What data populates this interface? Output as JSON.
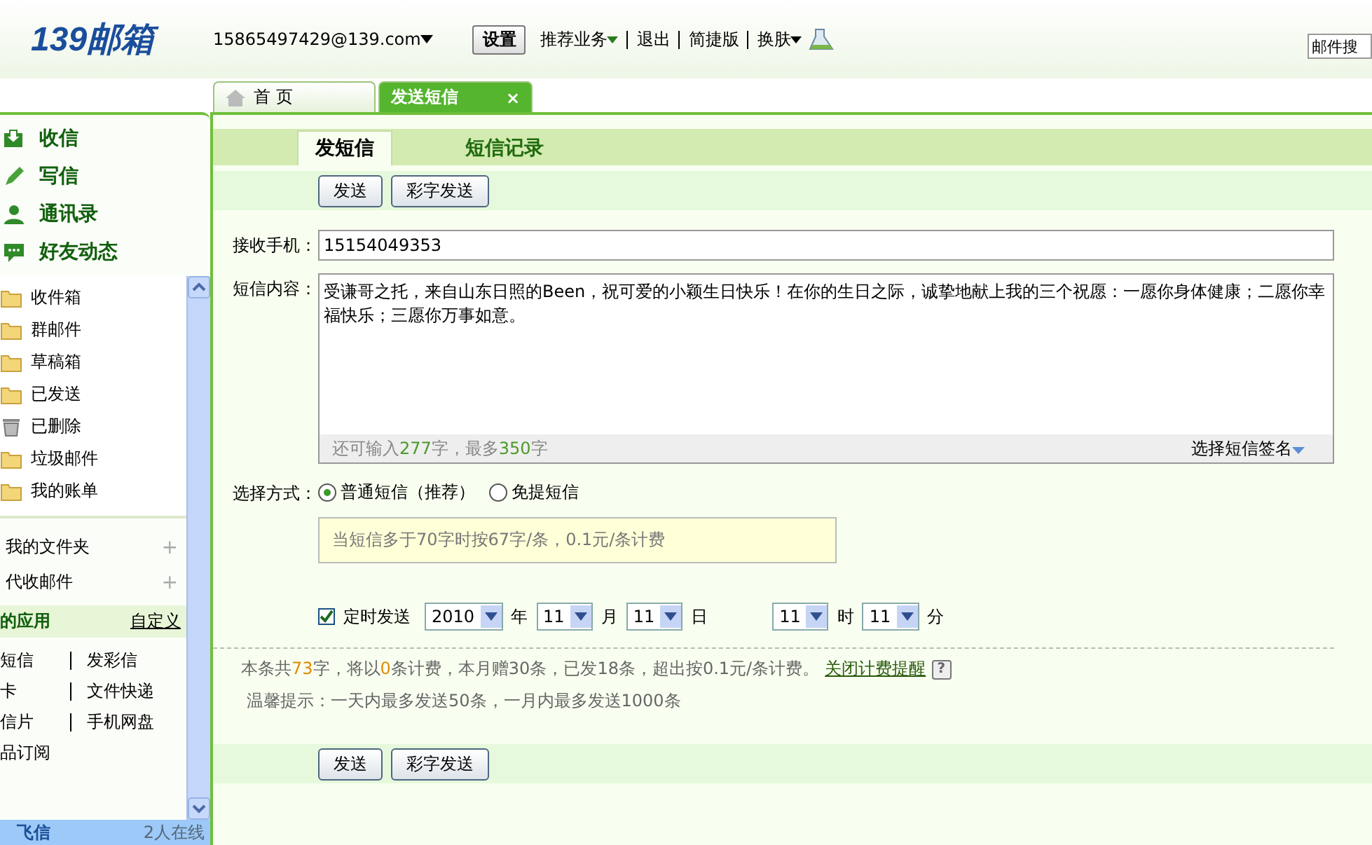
{
  "header": {
    "logo": "139邮箱",
    "account": "15865497429@139.com",
    "settings_button": "设置",
    "links": [
      {
        "label": "推荐业务",
        "dropdown": true
      },
      {
        "label": "退出",
        "dropdown": false
      },
      {
        "label": "简捷版",
        "dropdown": false
      },
      {
        "label": "换肤",
        "dropdown": true
      }
    ],
    "search_placeholder": "邮件搜"
  },
  "tabs": [
    {
      "kind": "home",
      "label": "首 页",
      "selected": false
    },
    {
      "kind": "page",
      "label": "发送短信",
      "selected": true,
      "close": "×"
    }
  ],
  "sidebar": {
    "actions": [
      "收信",
      "写信",
      "通讯录",
      "好友动态"
    ],
    "folders": [
      {
        "kind": "folder",
        "label": "收件箱"
      },
      {
        "kind": "folder",
        "label": "群邮件"
      },
      {
        "kind": "folder",
        "label": "草稿箱"
      },
      {
        "kind": "folder",
        "label": "已发送"
      },
      {
        "kind": "trash",
        "label": "已删除"
      },
      {
        "kind": "folder",
        "label": "垃圾邮件"
      },
      {
        "kind": "folder",
        "label": "我的账单"
      }
    ],
    "extras": [
      {
        "label": "我的文件夹",
        "expander": "+"
      },
      {
        "label": "代收邮件",
        "expander": "+"
      }
    ],
    "apps_title": "的应用",
    "apps_customize": "自定义",
    "apps": [
      [
        "短信",
        "发彩信"
      ],
      [
        "卡",
        "文件快递"
      ],
      [
        "信片",
        "手机网盘"
      ],
      [
        "品订阅"
      ]
    ],
    "fetion": {
      "name": "飞信",
      "online": "2人在线"
    }
  },
  "subtabs": [
    {
      "label": "发短信",
      "selected": true
    },
    {
      "label": "短信记录",
      "selected": false
    }
  ],
  "toolbar_buttons": [
    "发送",
    "彩字发送"
  ],
  "form": {
    "recipient_label": "接收手机：",
    "recipient": "15154049353",
    "content_label": "短信内容：",
    "content": "受谦哥之托，来自山东日照的Been，祝可爱的小颖生日快乐！在你的生日之际，诚挚地献上我的三个祝愿：一愿你身体健康；二愿你幸福快乐；三愿你万事如意。",
    "counter": [
      {
        "kind": "text",
        "text": "还可输入"
      },
      {
        "kind": "number",
        "text": "277"
      },
      {
        "kind": "text",
        "text": "字，最多"
      },
      {
        "kind": "number",
        "text": "350"
      },
      {
        "kind": "text",
        "text": "字"
      }
    ],
    "signature": "选择短信签名",
    "method_label": "选择方式：",
    "methods": [
      {
        "label": "普通短信（推荐）",
        "selected": true
      },
      {
        "label": "免提短信",
        "selected": false
      }
    ],
    "tip": "当短信多于70字时按67字/条，0.1元/条计费",
    "schedule": {
      "checked": true,
      "label": "定时发送",
      "date_parts": [
        {
          "value": "2010",
          "unit": "年"
        },
        {
          "value": "11",
          "unit": "月"
        },
        {
          "value": "11",
          "unit": "日"
        }
      ],
      "time_parts": [
        {
          "value": "11",
          "unit": "时"
        },
        {
          "value": "11",
          "unit": "分"
        }
      ]
    },
    "fee": [
      {
        "kind": "text",
        "text": "本条共"
      },
      {
        "kind": "number",
        "text": "73"
      },
      {
        "kind": "text",
        "text": "字，将以"
      },
      {
        "kind": "number",
        "text": "0"
      },
      {
        "kind": "text",
        "text": "条计费，本月赠30条，已发18条，超出按0.1元/条计费。"
      }
    ],
    "fee_link": "关闭计费提醒",
    "help": "?",
    "warm_tip": "温馨提示：一天内最多发送50条，一月内最多发送1000条"
  },
  "bottom_buttons": [
    "发送",
    "彩字发送"
  ]
}
